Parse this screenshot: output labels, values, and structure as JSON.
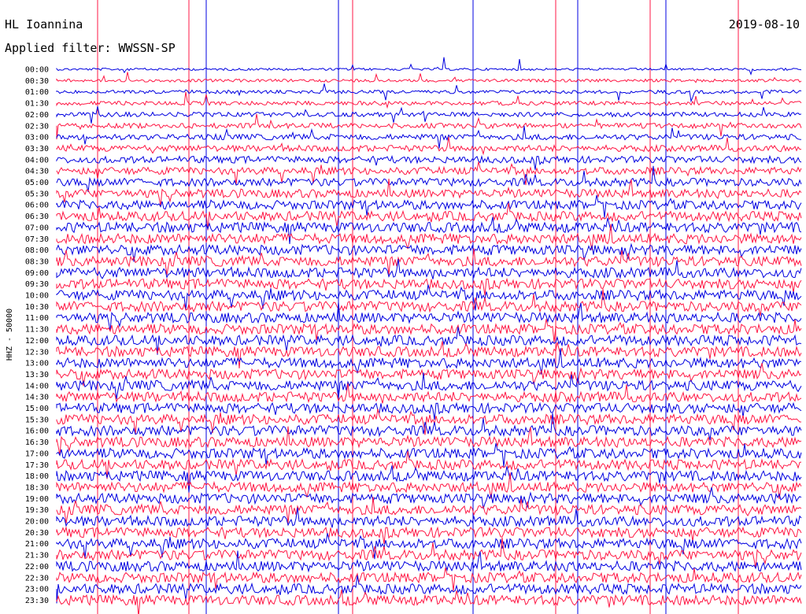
{
  "header": {
    "station": "HL Ioannina",
    "date": "2019-08-10",
    "filter": "Applied filter: WWSSN-SP"
  },
  "chart_data": {
    "type": "line",
    "title": "HL Ioannina",
    "subtitle": "Applied filter: WWSSN-SP",
    "date": "2019-08-10",
    "ylabel": "HHZ - 50000",
    "row_labels": [
      "00:00",
      "00:30",
      "01:00",
      "01:30",
      "02:00",
      "02:30",
      "03:00",
      "03:30",
      "04:00",
      "04:30",
      "05:00",
      "05:30",
      "06:00",
      "06:30",
      "07:00",
      "07:30",
      "08:00",
      "08:30",
      "09:00",
      "09:30",
      "10:00",
      "10:30",
      "11:00",
      "11:30",
      "12:00",
      "12:30",
      "13:00",
      "13:30",
      "14:00",
      "14:30",
      "15:00",
      "15:30",
      "16:00",
      "16:30",
      "17:00",
      "17:30",
      "18:00",
      "18:30",
      "19:00",
      "19:30",
      "20:00",
      "20:30",
      "21:00",
      "21:30",
      "22:00",
      "22:30",
      "23:00",
      "23:30"
    ],
    "colors": {
      "even_rows": "#0000e0",
      "odd_rows": "#ff1744"
    },
    "grid": false,
    "legend": "none"
  }
}
